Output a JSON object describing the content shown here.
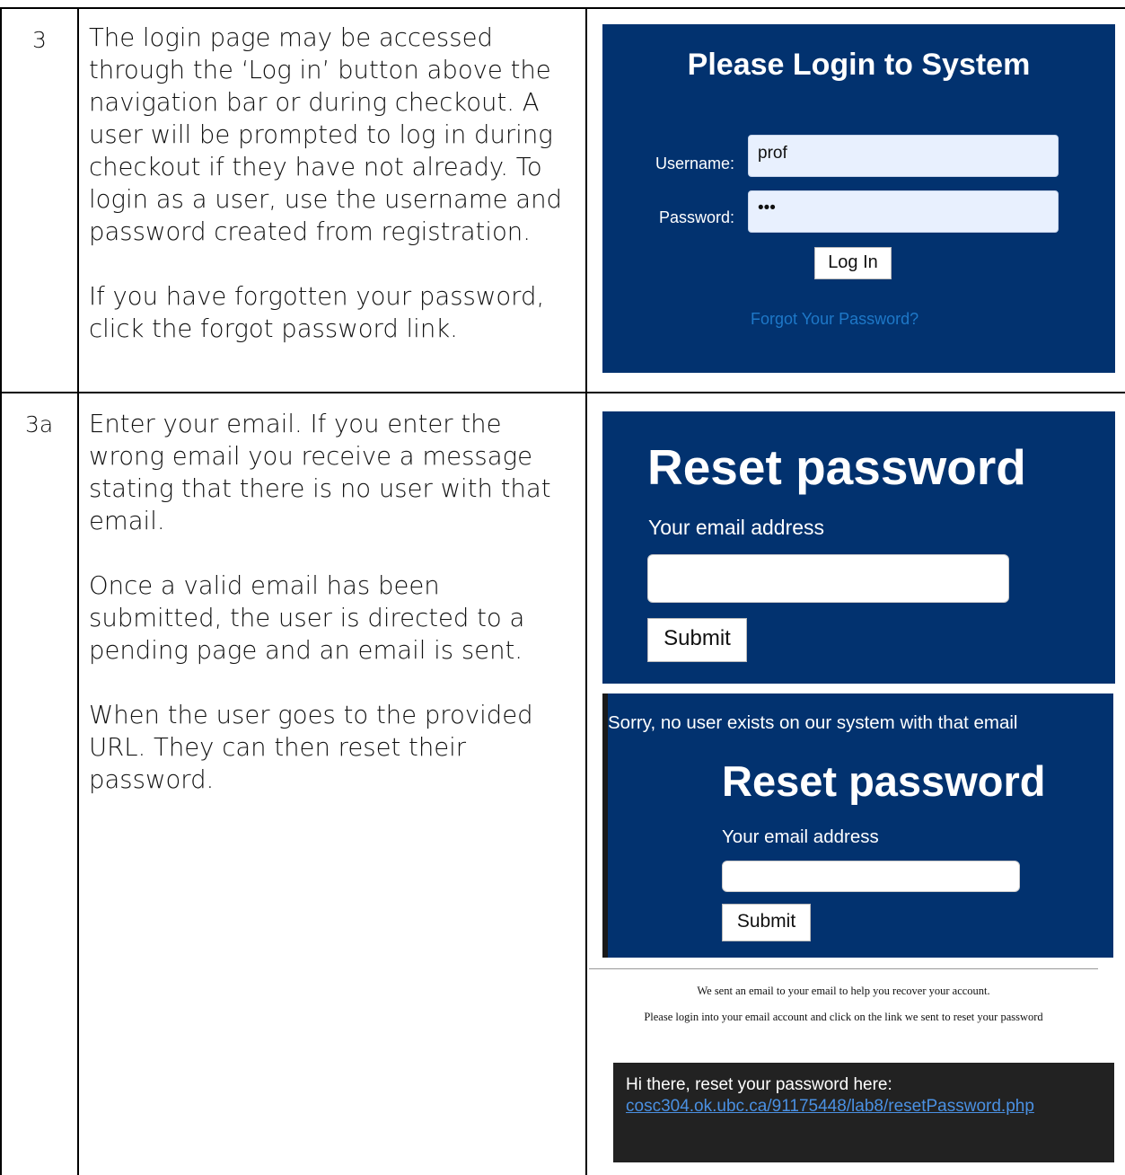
{
  "rows": [
    {
      "step": "3",
      "paragraphs": [
        "The login page may be accessed through the ‘Log in’ button above the navigation bar or during checkout. A user will be prompted to log in during checkout if they have not already. To login as a user, use the username and password created from registration.",
        "If you have forgotten your password, click the forgot password link."
      ]
    },
    {
      "step": "3a",
      "paragraphs": [
        "Enter your email. If you enter the wrong email you receive a message stating that there is no user with that email.",
        "Once a valid email has been submitted, the user is directed to a pending page and an email is sent.",
        "When the user goes to the provided URL. They can then reset their password."
      ]
    }
  ],
  "login": {
    "title": "Please Login to System",
    "username_label": "Username:",
    "username_value": "prof",
    "password_label": "Password:",
    "password_value": "•••",
    "login_button": "Log In",
    "forgot_link": "Forgot Your Password?"
  },
  "reset1": {
    "title": "Reset password",
    "email_label": "Your email address",
    "email_value": "",
    "submit_button": "Submit"
  },
  "reset2": {
    "error": "Sorry, no user exists on our system with that email",
    "title": "Reset password",
    "email_label": "Your email address",
    "email_value": "",
    "submit_button": "Submit"
  },
  "pending": {
    "line1": "We sent an email to your email to help you recover your account.",
    "line2": "Please login into your email account and click on the link we sent to reset your password"
  },
  "email": {
    "greeting": "Hi there, reset your password here:",
    "link": "cosc304.ok.ubc.ca/91175448/lab8/resetPassword.php"
  },
  "colors": {
    "navy": "#02326f",
    "field_autofill": "#e8f0fe",
    "link_blue": "#1e78c8",
    "email_bg": "#222222"
  }
}
